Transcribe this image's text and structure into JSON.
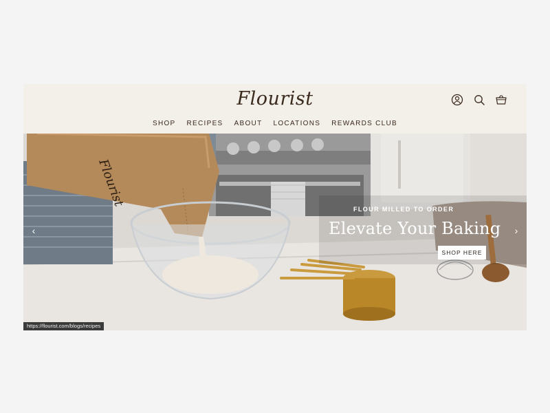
{
  "brand": {
    "logo_text": "Flourist"
  },
  "header": {
    "icons": [
      "account-icon",
      "search-icon",
      "cart-icon"
    ]
  },
  "nav": {
    "items": [
      "SHOP",
      "RECIPES",
      "ABOUT",
      "LOCATIONS",
      "REWARDS CLUB"
    ]
  },
  "hero": {
    "eyebrow": "FLOUR MILLED TO ORDER",
    "headline": "Elevate Your Baking",
    "cta_label": "SHOP HERE",
    "prev_arrow": "‹",
    "next_arrow": "›"
  },
  "status_bar": {
    "url": "https://flourist.com/blogs/recipes"
  },
  "colors": {
    "page_bg": "#f4f4f4",
    "header_bg": "#f3efe9",
    "brand_text": "#3b2a1e",
    "cta_bg": "#ffffff"
  }
}
